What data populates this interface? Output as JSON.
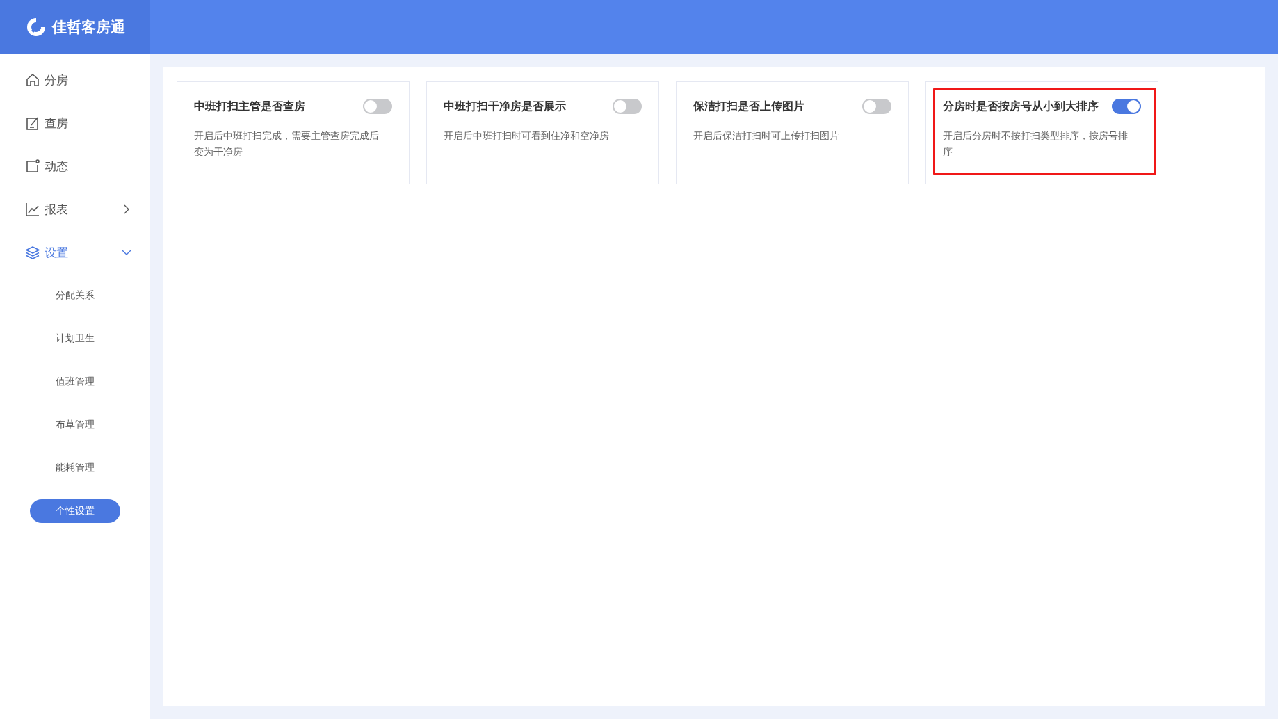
{
  "brand": {
    "name": "佳哲客房通"
  },
  "sidebar": {
    "items": [
      {
        "label": "分房",
        "selected": false
      },
      {
        "label": "查房",
        "selected": false
      },
      {
        "label": "动态",
        "selected": false
      },
      {
        "label": "报表",
        "selected": false,
        "expanded": false
      },
      {
        "label": "设置",
        "selected": true,
        "expanded": true,
        "children": [
          {
            "label": "分配关系",
            "selected": false
          },
          {
            "label": "计划卫生",
            "selected": false
          },
          {
            "label": "值班管理",
            "selected": false
          },
          {
            "label": "布草管理",
            "selected": false
          },
          {
            "label": "能耗管理",
            "selected": false
          },
          {
            "label": "个性设置",
            "selected": true
          }
        ]
      }
    ]
  },
  "settings": [
    {
      "title": "中班打扫主管是否查房",
      "description": "开启后中班打扫完成，需要主管查房完成后变为干净房",
      "on": false,
      "highlighted": false
    },
    {
      "title": "中班打扫干净房是否展示",
      "description": "开启后中班打扫时可看到住净和空净房",
      "on": false,
      "highlighted": false
    },
    {
      "title": "保洁打扫是否上传图片",
      "description": "开启后保洁打扫时可上传打扫图片",
      "on": false,
      "highlighted": false
    },
    {
      "title": "分房时是否按房号从小到大排序",
      "description": "开启后分房时不按打扫类型排序，按房号排序",
      "on": true,
      "highlighted": true
    }
  ]
}
